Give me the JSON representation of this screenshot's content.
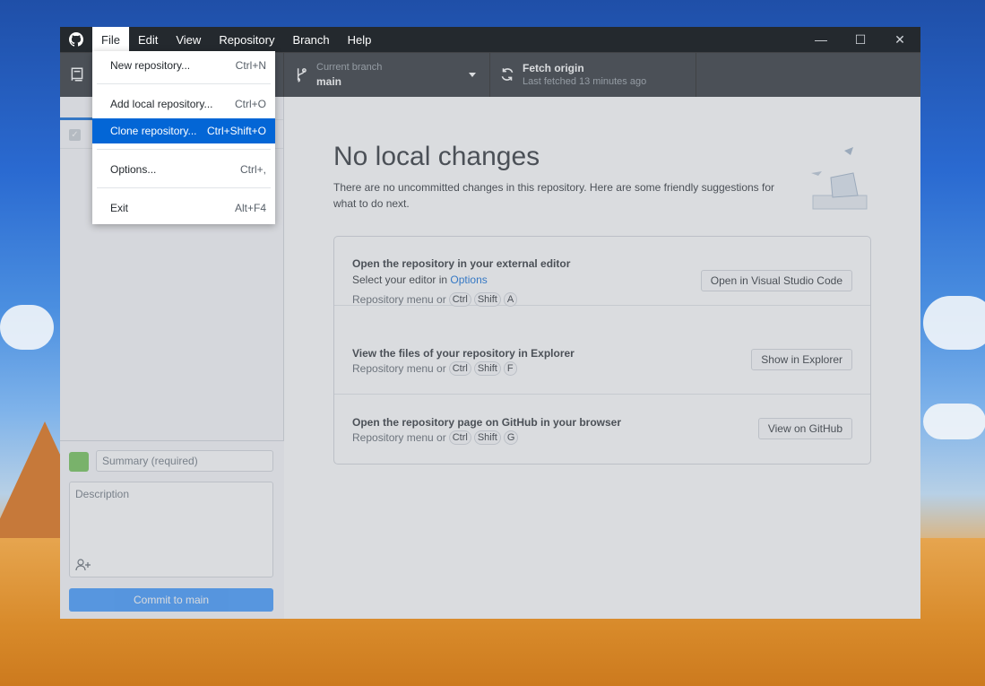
{
  "menubar": {
    "items": [
      {
        "label": "File"
      },
      {
        "label": "Edit"
      },
      {
        "label": "View"
      },
      {
        "label": "Repository"
      },
      {
        "label": "Branch"
      },
      {
        "label": "Help"
      }
    ]
  },
  "window_controls": {
    "minimize": "—",
    "maximize": "☐",
    "close": "✕"
  },
  "toolbar": {
    "branch_label": "Current branch",
    "branch_value": "main",
    "fetch_label": "Fetch origin",
    "fetch_sub": "Last fetched 13 minutes ago"
  },
  "file_menu": {
    "items": [
      {
        "label": "New repository...",
        "accel": "Ctrl+N"
      },
      {
        "label": "Add local repository...",
        "accel": "Ctrl+O"
      },
      {
        "label": "Clone repository...",
        "accel": "Ctrl+Shift+O"
      },
      {
        "label": "Options...",
        "accel": "Ctrl+,"
      },
      {
        "label": "Exit",
        "accel": "Alt+F4"
      }
    ],
    "selected_index": 2
  },
  "commit": {
    "summary_placeholder": "Summary (required)",
    "description_placeholder": "Description",
    "button_label": "Commit to main"
  },
  "main": {
    "heading": "No local changes",
    "subtext": "There are no uncommitted changes in this repository. Here are some friendly suggestions for what to do next.",
    "cards": [
      {
        "title": "Open the repository in your external editor",
        "line_prefix": "Select your editor in ",
        "line_link": "Options",
        "hint": "Repository menu or",
        "keys": [
          "Ctrl",
          "Shift",
          "A"
        ],
        "button": "Open in Visual Studio Code"
      },
      {
        "title": "View the files of your repository in Explorer",
        "hint": "Repository menu or",
        "keys": [
          "Ctrl",
          "Shift",
          "F"
        ],
        "button": "Show in Explorer"
      },
      {
        "title": "Open the repository page on GitHub in your browser",
        "hint": "Repository menu or",
        "keys": [
          "Ctrl",
          "Shift",
          "G"
        ],
        "button": "View on GitHub"
      }
    ]
  },
  "colors": {
    "titlebar": "#24292e",
    "accent": "#0366d6",
    "commit_button": "#2188ff"
  }
}
